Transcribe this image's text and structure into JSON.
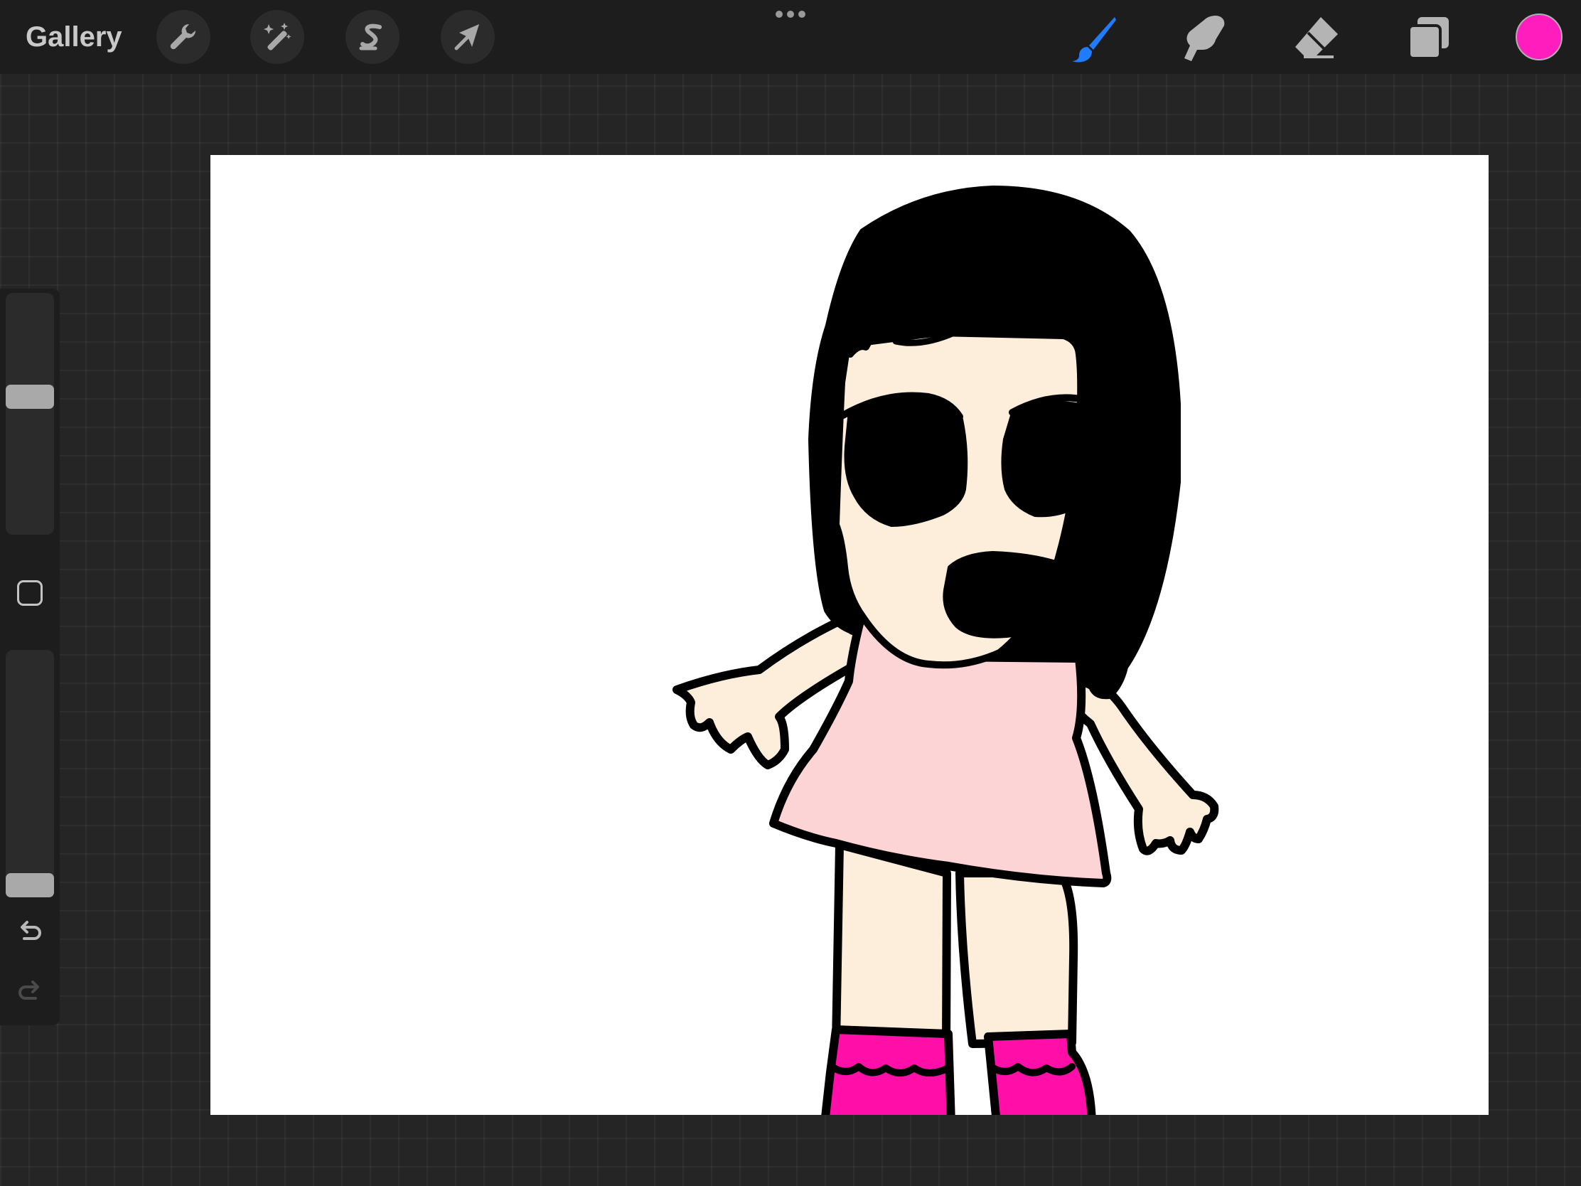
{
  "toolbar": {
    "gallery_label": "Gallery",
    "actions_icon": "wrench-icon",
    "adjustments_icon": "magic-wand-icon",
    "selection_icon": "selection-s-icon",
    "transform_icon": "arrow-cursor-icon",
    "more_icon": "three-dots-icon"
  },
  "tools": {
    "brush": {
      "icon": "paintbrush-icon",
      "active": true,
      "color": "#1f7cff"
    },
    "smudge": {
      "icon": "smudge-finger-icon"
    },
    "eraser": {
      "icon": "eraser-icon"
    },
    "layers": {
      "icon": "layers-icon"
    },
    "current_color": "#ff1ebd"
  },
  "sidebar": {
    "brush_size_level": 0.58,
    "opacity_level": 0.0,
    "modify_icon": "square-modify-icon",
    "undo_icon": "undo-arrow-icon",
    "redo_icon": "redo-arrow-icon"
  },
  "canvas": {
    "background": "#ffffff",
    "colors": {
      "hair": "#000000",
      "skin": "#fdeedc",
      "dress": "#fdd4d6",
      "boots": "#ff0fa8",
      "outline": "#000000"
    }
  }
}
